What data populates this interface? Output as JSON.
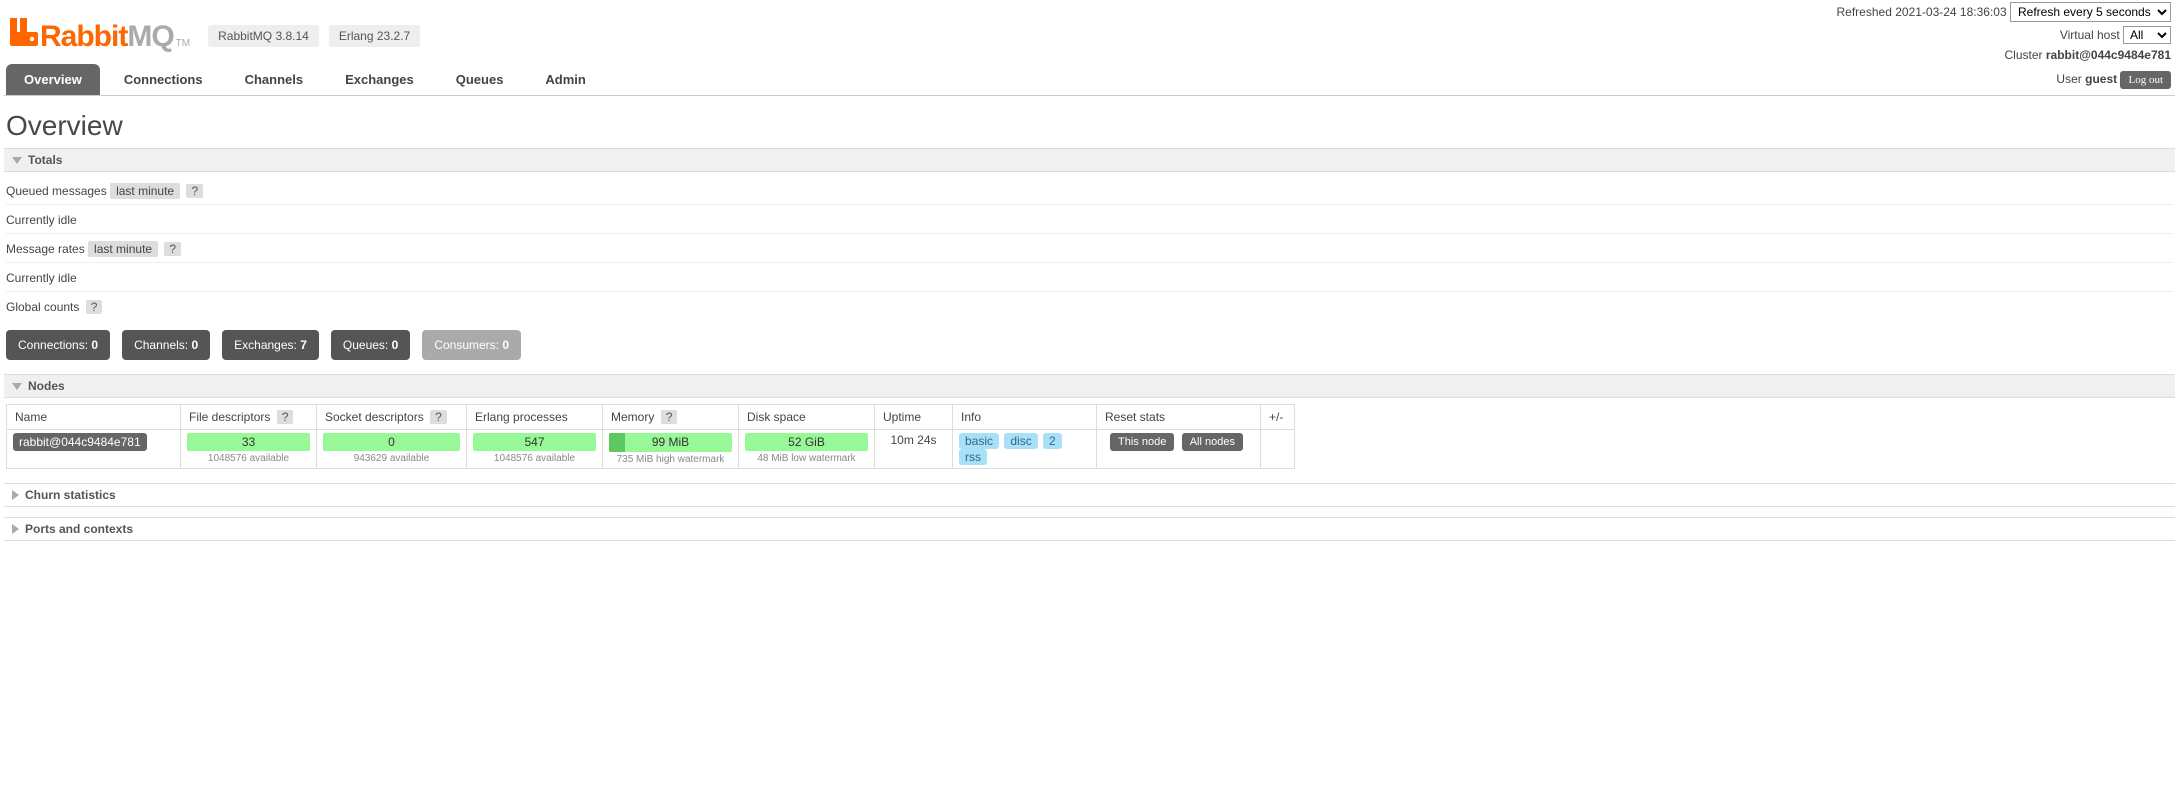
{
  "top": {
    "refreshed_label": "Refreshed",
    "refreshed_time": "2021-03-24 18:36:03",
    "refresh_select": "Refresh every 5 seconds",
    "vhost_label": "Virtual host",
    "vhost_value": "All",
    "cluster_label": "Cluster",
    "cluster_value": "rabbit@044c9484e781",
    "user_label": "User",
    "user_value": "guest",
    "logout_label": "Log out"
  },
  "logo": {
    "rabbit": "Rabbit",
    "mq": "MQ",
    "tm": "TM"
  },
  "versions": {
    "rabbitmq": "RabbitMQ 3.8.14",
    "erlang": "Erlang 23.2.7"
  },
  "tabs": [
    "Overview",
    "Connections",
    "Channels",
    "Exchanges",
    "Queues",
    "Admin"
  ],
  "page_title": "Overview",
  "totals": {
    "header": "Totals",
    "queued_label": "Queued messages",
    "last_minute": "last minute",
    "help": "?",
    "idle1": "Currently idle",
    "rates_label": "Message rates",
    "idle2": "Currently idle",
    "global_label": "Global counts",
    "counts": [
      {
        "label": "Connections:",
        "value": "0",
        "disabled": false
      },
      {
        "label": "Channels:",
        "value": "0",
        "disabled": false
      },
      {
        "label": "Exchanges:",
        "value": "7",
        "disabled": false
      },
      {
        "label": "Queues:",
        "value": "0",
        "disabled": false
      },
      {
        "label": "Consumers:",
        "value": "0",
        "disabled": true
      }
    ]
  },
  "nodes": {
    "header": "Nodes",
    "cols": {
      "name": "Name",
      "fd": "File descriptors",
      "sd": "Socket descriptors",
      "ep": "Erlang processes",
      "mem": "Memory",
      "disk": "Disk space",
      "uptime": "Uptime",
      "info": "Info",
      "reset": "Reset stats",
      "pm": "+/-"
    },
    "row": {
      "name": "rabbit@044c9484e781",
      "fd_val": "33",
      "fd_sub": "1048576 available",
      "sd_val": "0",
      "sd_sub": "943629 available",
      "ep_val": "547",
      "ep_sub": "1048576 available",
      "mem_val": "99 MiB",
      "mem_sub": "735 MiB high watermark",
      "disk_val": "52 GiB",
      "disk_sub": "48 MiB low watermark",
      "uptime": "10m 24s",
      "info_tags": [
        "basic",
        "disc",
        "2",
        "rss"
      ],
      "reset_this": "This node",
      "reset_all": "All nodes"
    }
  },
  "churn": {
    "header": "Churn statistics"
  },
  "ports": {
    "header": "Ports and contexts"
  }
}
